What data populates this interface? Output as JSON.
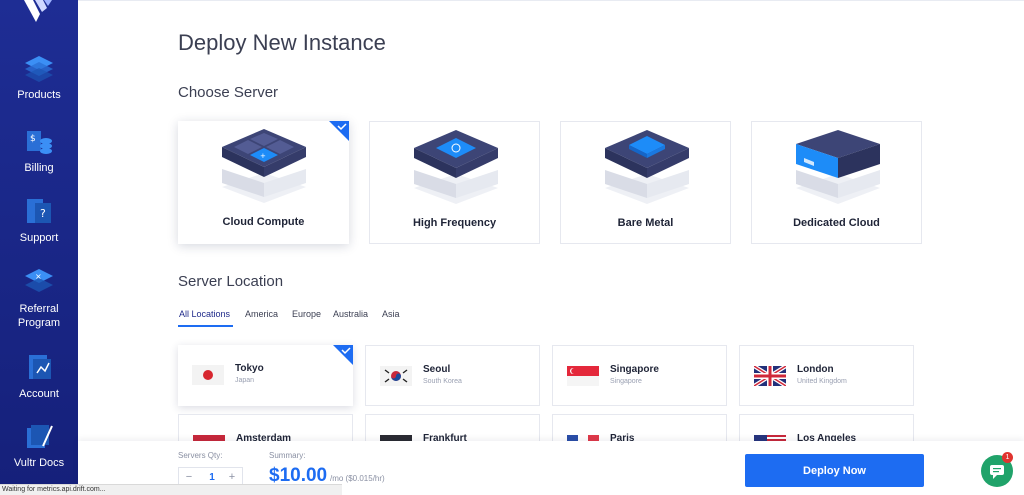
{
  "sidebar": {
    "items": [
      {
        "label": "Products",
        "icon": "products-icon"
      },
      {
        "label": "Billing",
        "icon": "billing-icon"
      },
      {
        "label": "Support",
        "icon": "support-icon"
      },
      {
        "label": "Referral\nProgram",
        "icon": "referral-icon"
      },
      {
        "label": "Account",
        "icon": "account-icon"
      },
      {
        "label": "Vultr Docs",
        "icon": "docs-icon"
      }
    ]
  },
  "page": {
    "title": "Deploy New Instance",
    "choose_server_heading": "Choose Server",
    "server_location_heading": "Server Location"
  },
  "servers": [
    {
      "label": "Cloud Compute",
      "selected": true
    },
    {
      "label": "High Frequency",
      "selected": false
    },
    {
      "label": "Bare Metal",
      "selected": false
    },
    {
      "label": "Dedicated Cloud",
      "selected": false
    }
  ],
  "location_tabs": [
    "All Locations",
    "America",
    "Europe",
    "Australia",
    "Asia"
  ],
  "active_tab": "All Locations",
  "locations": [
    {
      "city": "Tokyo",
      "country": "Japan",
      "flag": "japan-flag",
      "selected": true
    },
    {
      "city": "Seoul",
      "country": "South Korea",
      "flag": "south-korea-flag",
      "selected": false
    },
    {
      "city": "Singapore",
      "country": "Singapore",
      "flag": "singapore-flag",
      "selected": false
    },
    {
      "city": "London",
      "country": "United Kingdom",
      "flag": "uk-flag",
      "selected": false
    },
    {
      "city": "Amsterdam",
      "country": "",
      "flag": "netherlands-flag",
      "selected": false
    },
    {
      "city": "Frankfurt",
      "country": "",
      "flag": "germany-flag",
      "selected": false
    },
    {
      "city": "Paris",
      "country": "",
      "flag": "france-flag",
      "selected": false
    },
    {
      "city": "Los Angeles",
      "country": "",
      "flag": "usa-flag",
      "selected": false
    }
  ],
  "summary": {
    "qty_label": "Servers Qty:",
    "qty_value": "1",
    "minus": "−",
    "plus": "+",
    "summary_label": "Summary:",
    "price": "$10.00",
    "price_unit": "/mo ($0.015/hr)",
    "deploy_label": "Deploy Now"
  },
  "chat": {
    "badge": "1"
  },
  "status_text": "Waiting for metrics.api.drift.com...",
  "colors": {
    "sidebar": "#1b2a8c",
    "accent": "#1d6cf2",
    "chat": "#20a36a"
  }
}
